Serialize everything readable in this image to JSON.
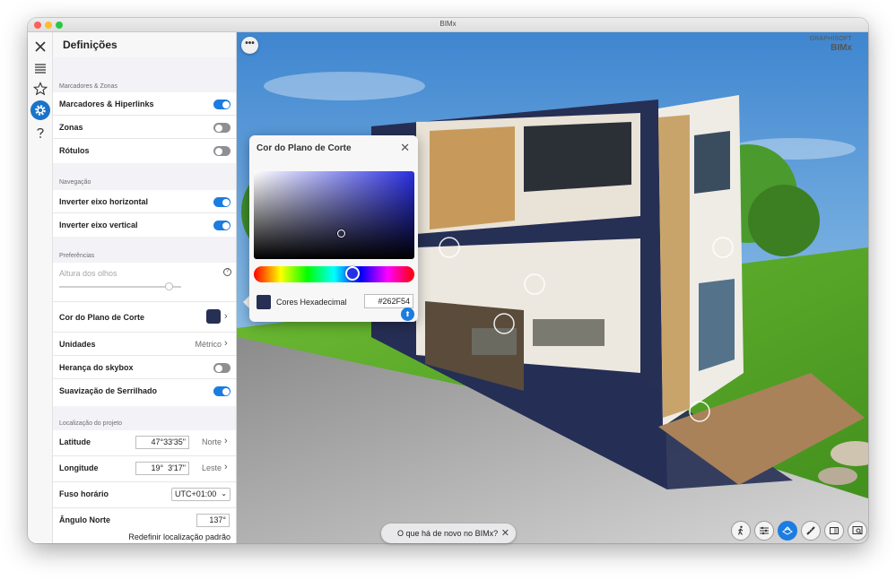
{
  "window": {
    "title": "BIMx"
  },
  "rail": {
    "items": [
      {
        "icon": "close-icon"
      },
      {
        "icon": "list-icon"
      },
      {
        "icon": "star-icon"
      },
      {
        "icon": "gear-icon"
      },
      {
        "icon": "help-icon"
      }
    ]
  },
  "panel": {
    "title": "Definições",
    "sections": {
      "markers": "Marcadores & Zonas",
      "navigation": "Navegação",
      "preferences": "Preferências",
      "location": "Localização do projeto"
    },
    "markers_hyperlinks": {
      "label": "Marcadores & Hiperlinks",
      "on": true
    },
    "zones": {
      "label": "Zonas",
      "on": false
    },
    "labels": {
      "label": "Rótulos",
      "on": false
    },
    "invert_horizontal": {
      "label": "Inverter eixo horizontal",
      "on": true
    },
    "invert_vertical": {
      "label": "Inverter eixo vertical",
      "on": true
    },
    "eye_height": {
      "label": "Altura dos olhos",
      "help": "?",
      "level": 0.9
    },
    "cut_plane_color": {
      "label": "Cor do Plano de Corte",
      "color": "#262F54"
    },
    "units": {
      "label": "Unidades",
      "value": "Métrico"
    },
    "skybox": {
      "label": "Herança do skybox",
      "on": false
    },
    "antialiasing": {
      "label": "Suavização de Serrilhado",
      "on": true
    },
    "latitude": {
      "label": "Latitude",
      "value": "47°33'35\"",
      "hemisphere": "Norte"
    },
    "longitude": {
      "label": "Longitude",
      "value": "19°  3'17\"",
      "hemisphere": "Leste"
    },
    "timezone": {
      "label": "Fuso horário",
      "value": "UTC+01:00"
    },
    "north_angle": {
      "label": "Ângulo Norte",
      "value": "137°"
    },
    "reset_location": "Redefinir localização padrão"
  },
  "viewport": {
    "more_label": "•••",
    "logo": {
      "line1": "GRAPHISOFT",
      "line2": "BIMx"
    }
  },
  "color_popover": {
    "title": "Cor do Plano de Corte",
    "hex_label": "Cores Hexadecimal",
    "hex_value": "#262F54",
    "selected_color": "#262F54"
  },
  "news": {
    "label": "O que há de novo no BIMx?"
  },
  "toolbar": {
    "buttons": [
      {
        "icon": "walk-icon",
        "active": false
      },
      {
        "icon": "sliders-icon",
        "active": false
      },
      {
        "icon": "cutaway-icon",
        "active": true
      },
      {
        "icon": "measure-icon",
        "active": false
      },
      {
        "icon": "sheet-icon",
        "active": false
      },
      {
        "icon": "zoom-view-icon",
        "active": false
      }
    ]
  },
  "colors": {
    "accent": "#1C7CE0",
    "house_cut": "#262F54",
    "grass": "#5DAA2A",
    "sky": "#5A9BD8"
  }
}
